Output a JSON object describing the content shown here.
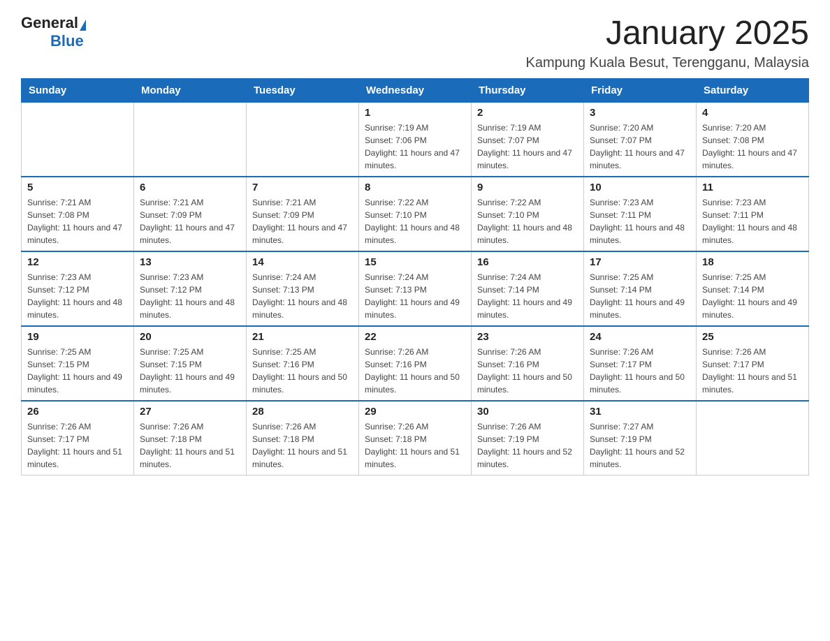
{
  "header": {
    "logo_general": "General",
    "logo_blue": "Blue",
    "month_title": "January 2025",
    "location": "Kampung Kuala Besut, Terengganu, Malaysia"
  },
  "days_of_week": [
    "Sunday",
    "Monday",
    "Tuesday",
    "Wednesday",
    "Thursday",
    "Friday",
    "Saturday"
  ],
  "weeks": [
    [
      {
        "day": "",
        "info": ""
      },
      {
        "day": "",
        "info": ""
      },
      {
        "day": "",
        "info": ""
      },
      {
        "day": "1",
        "info": "Sunrise: 7:19 AM\nSunset: 7:06 PM\nDaylight: 11 hours and 47 minutes."
      },
      {
        "day": "2",
        "info": "Sunrise: 7:19 AM\nSunset: 7:07 PM\nDaylight: 11 hours and 47 minutes."
      },
      {
        "day": "3",
        "info": "Sunrise: 7:20 AM\nSunset: 7:07 PM\nDaylight: 11 hours and 47 minutes."
      },
      {
        "day": "4",
        "info": "Sunrise: 7:20 AM\nSunset: 7:08 PM\nDaylight: 11 hours and 47 minutes."
      }
    ],
    [
      {
        "day": "5",
        "info": "Sunrise: 7:21 AM\nSunset: 7:08 PM\nDaylight: 11 hours and 47 minutes."
      },
      {
        "day": "6",
        "info": "Sunrise: 7:21 AM\nSunset: 7:09 PM\nDaylight: 11 hours and 47 minutes."
      },
      {
        "day": "7",
        "info": "Sunrise: 7:21 AM\nSunset: 7:09 PM\nDaylight: 11 hours and 47 minutes."
      },
      {
        "day": "8",
        "info": "Sunrise: 7:22 AM\nSunset: 7:10 PM\nDaylight: 11 hours and 48 minutes."
      },
      {
        "day": "9",
        "info": "Sunrise: 7:22 AM\nSunset: 7:10 PM\nDaylight: 11 hours and 48 minutes."
      },
      {
        "day": "10",
        "info": "Sunrise: 7:23 AM\nSunset: 7:11 PM\nDaylight: 11 hours and 48 minutes."
      },
      {
        "day": "11",
        "info": "Sunrise: 7:23 AM\nSunset: 7:11 PM\nDaylight: 11 hours and 48 minutes."
      }
    ],
    [
      {
        "day": "12",
        "info": "Sunrise: 7:23 AM\nSunset: 7:12 PM\nDaylight: 11 hours and 48 minutes."
      },
      {
        "day": "13",
        "info": "Sunrise: 7:23 AM\nSunset: 7:12 PM\nDaylight: 11 hours and 48 minutes."
      },
      {
        "day": "14",
        "info": "Sunrise: 7:24 AM\nSunset: 7:13 PM\nDaylight: 11 hours and 48 minutes."
      },
      {
        "day": "15",
        "info": "Sunrise: 7:24 AM\nSunset: 7:13 PM\nDaylight: 11 hours and 49 minutes."
      },
      {
        "day": "16",
        "info": "Sunrise: 7:24 AM\nSunset: 7:14 PM\nDaylight: 11 hours and 49 minutes."
      },
      {
        "day": "17",
        "info": "Sunrise: 7:25 AM\nSunset: 7:14 PM\nDaylight: 11 hours and 49 minutes."
      },
      {
        "day": "18",
        "info": "Sunrise: 7:25 AM\nSunset: 7:14 PM\nDaylight: 11 hours and 49 minutes."
      }
    ],
    [
      {
        "day": "19",
        "info": "Sunrise: 7:25 AM\nSunset: 7:15 PM\nDaylight: 11 hours and 49 minutes."
      },
      {
        "day": "20",
        "info": "Sunrise: 7:25 AM\nSunset: 7:15 PM\nDaylight: 11 hours and 49 minutes."
      },
      {
        "day": "21",
        "info": "Sunrise: 7:25 AM\nSunset: 7:16 PM\nDaylight: 11 hours and 50 minutes."
      },
      {
        "day": "22",
        "info": "Sunrise: 7:26 AM\nSunset: 7:16 PM\nDaylight: 11 hours and 50 minutes."
      },
      {
        "day": "23",
        "info": "Sunrise: 7:26 AM\nSunset: 7:16 PM\nDaylight: 11 hours and 50 minutes."
      },
      {
        "day": "24",
        "info": "Sunrise: 7:26 AM\nSunset: 7:17 PM\nDaylight: 11 hours and 50 minutes."
      },
      {
        "day": "25",
        "info": "Sunrise: 7:26 AM\nSunset: 7:17 PM\nDaylight: 11 hours and 51 minutes."
      }
    ],
    [
      {
        "day": "26",
        "info": "Sunrise: 7:26 AM\nSunset: 7:17 PM\nDaylight: 11 hours and 51 minutes."
      },
      {
        "day": "27",
        "info": "Sunrise: 7:26 AM\nSunset: 7:18 PM\nDaylight: 11 hours and 51 minutes."
      },
      {
        "day": "28",
        "info": "Sunrise: 7:26 AM\nSunset: 7:18 PM\nDaylight: 11 hours and 51 minutes."
      },
      {
        "day": "29",
        "info": "Sunrise: 7:26 AM\nSunset: 7:18 PM\nDaylight: 11 hours and 51 minutes."
      },
      {
        "day": "30",
        "info": "Sunrise: 7:26 AM\nSunset: 7:19 PM\nDaylight: 11 hours and 52 minutes."
      },
      {
        "day": "31",
        "info": "Sunrise: 7:27 AM\nSunset: 7:19 PM\nDaylight: 11 hours and 52 minutes."
      },
      {
        "day": "",
        "info": ""
      }
    ]
  ]
}
